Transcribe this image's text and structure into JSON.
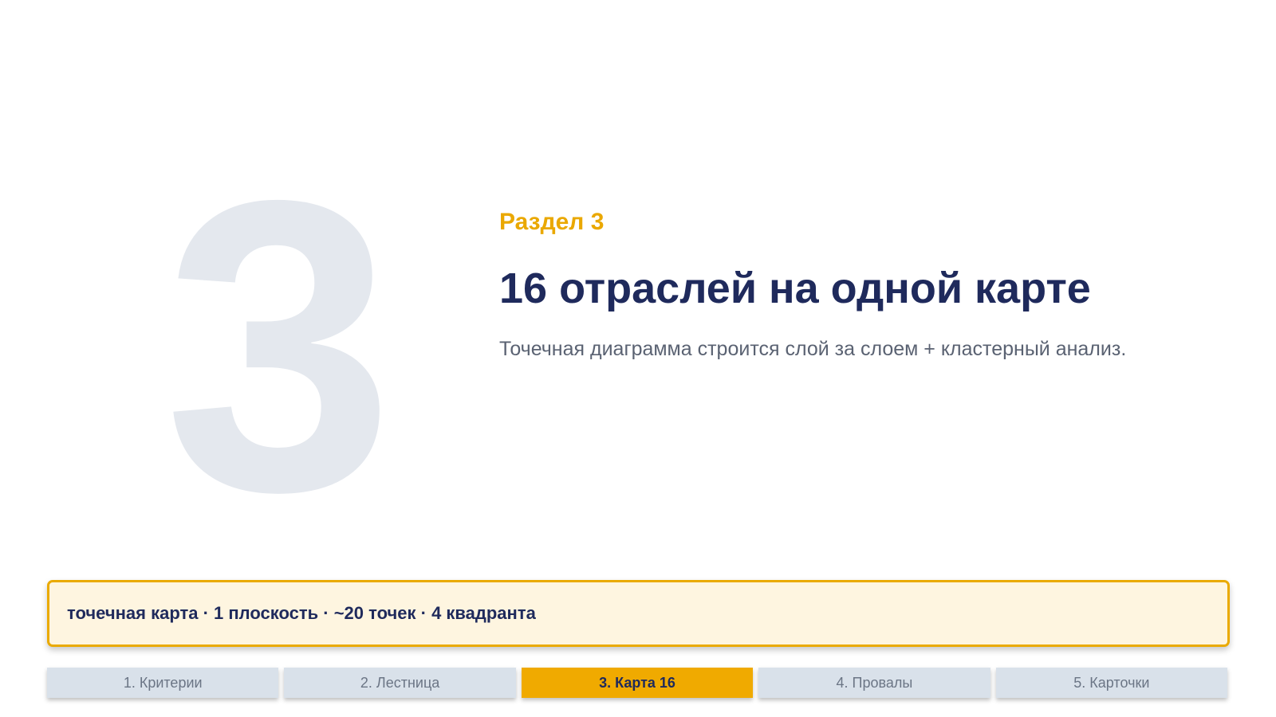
{
  "section": {
    "number": "3",
    "label": "Раздел 3",
    "title": "16 отраслей на одной карте",
    "subtitle": "Точечная диаграмма строится слой за слоем + кластерный анализ."
  },
  "summary": {
    "text": "точечная карта · 1 плоскость · ~20 точек · 4 квадранта"
  },
  "nav": {
    "items": [
      {
        "label": "1. Критерии",
        "active": false
      },
      {
        "label": "2. Лестница",
        "active": false
      },
      {
        "label": "3. Карта 16",
        "active": true
      },
      {
        "label": "4. Провалы",
        "active": false
      },
      {
        "label": "5. Карточки",
        "active": false
      }
    ]
  },
  "colors": {
    "accent": "#f0aa00",
    "title": "#1f2a5c",
    "subtitle": "#5a6272",
    "summary_bg": "#fef5e0",
    "nav_bg": "#d9e1ea",
    "big_number": "#e4e8ee"
  }
}
